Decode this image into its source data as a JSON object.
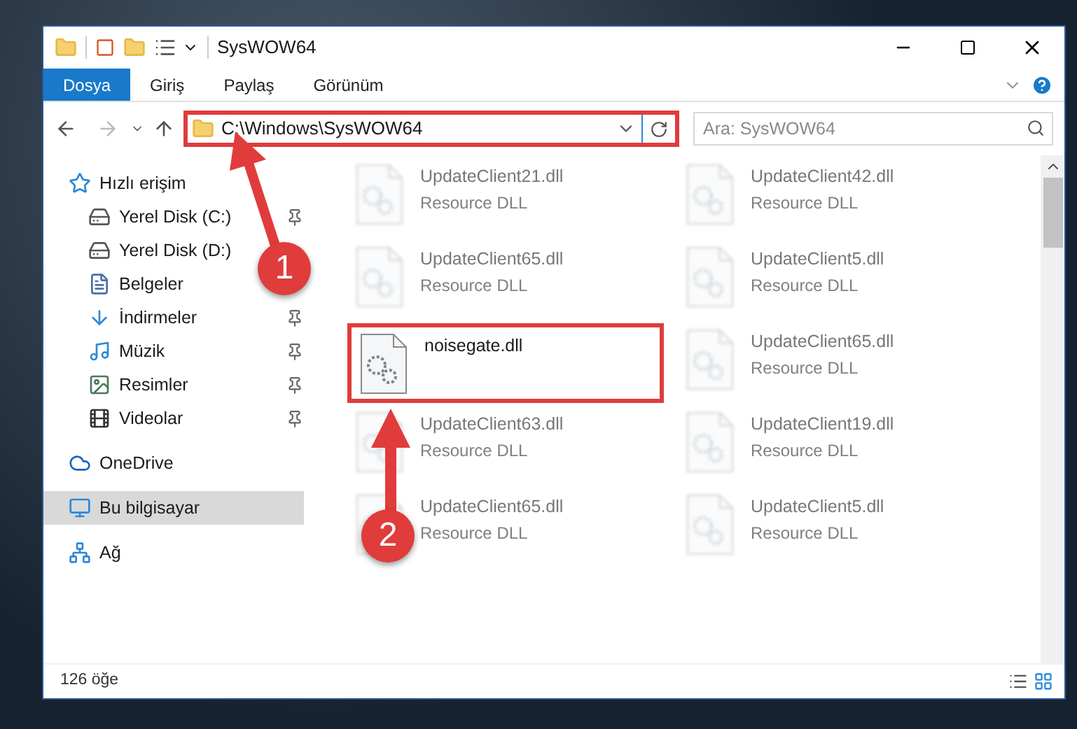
{
  "window": {
    "title": "SysWOW64"
  },
  "ribbon_tabs": [
    {
      "label": "Dosya",
      "selected": true
    },
    {
      "label": "Giriş",
      "selected": false
    },
    {
      "label": "Paylaş",
      "selected": false
    },
    {
      "label": "Görünüm",
      "selected": false
    }
  ],
  "address_bar": {
    "path": "C:\\Windows\\SysWOW64",
    "highlighted": true
  },
  "search": {
    "placeholder": "Ara: SysWOW64"
  },
  "sidebar": {
    "items": [
      {
        "label": "Hızlı erişim",
        "kind": "star",
        "selected": false,
        "children": [
          {
            "label": "Yerel Disk (C:)",
            "kind": "system-drive",
            "pinned": true,
            "selected": false
          },
          {
            "label": "Yerel Disk (D:)",
            "kind": "drive",
            "pinned": false,
            "selected": false
          },
          {
            "label": "Belgeler",
            "kind": "documents",
            "pinned": false,
            "selected": false
          },
          {
            "label": "İndirmeler",
            "kind": "downloads",
            "pinned": true,
            "selected": false
          },
          {
            "label": "Müzik",
            "kind": "music",
            "pinned": true,
            "selected": false
          },
          {
            "label": "Resimler",
            "kind": "pictures",
            "pinned": true,
            "selected": false
          },
          {
            "label": "Videolar",
            "kind": "videos",
            "pinned": true,
            "selected": false
          }
        ]
      },
      {
        "label": "OneDrive",
        "kind": "cloud",
        "selected": false
      },
      {
        "label": "Bu bilgisayar",
        "kind": "computer",
        "selected": true
      },
      {
        "label": "Ağ",
        "kind": "network",
        "selected": false
      }
    ]
  },
  "files": [
    {
      "name": "UpdateClient21.dll",
      "type": "Resource DLL",
      "blurred": true,
      "highlighted": false
    },
    {
      "name": "UpdateClient42.dll",
      "type": "Resource DLL",
      "blurred": true,
      "highlighted": false
    },
    {
      "name": "UpdateClient65.dll",
      "type": "Resource DLL",
      "blurred": true,
      "highlighted": false
    },
    {
      "name": "UpdateClient5.dll",
      "type": "Resource DLL",
      "blurred": true,
      "highlighted": false
    },
    {
      "name": "noisegate.dll",
      "blurred": false,
      "highlighted": true
    },
    {
      "name": "UpdateClient65.dll",
      "type": "Resource DLL",
      "blurred": true,
      "highlighted": false
    },
    {
      "name": "UpdateClient63.dll",
      "type": "Resource DLL",
      "blurred": true,
      "highlighted": false
    },
    {
      "name": "UpdateClient19.dll",
      "type": "Resource DLL",
      "blurred": true,
      "highlighted": false
    },
    {
      "name": "UpdateClient65.dll",
      "type": "Resource DLL",
      "blurred": true,
      "highlighted": false
    },
    {
      "name": "UpdateClient5.dll",
      "type": "Resource DLL",
      "blurred": true,
      "highlighted": false
    }
  ],
  "status_bar": {
    "count": "126 öğe"
  },
  "annotations": [
    {
      "number": "1"
    },
    {
      "number": "2"
    }
  ]
}
